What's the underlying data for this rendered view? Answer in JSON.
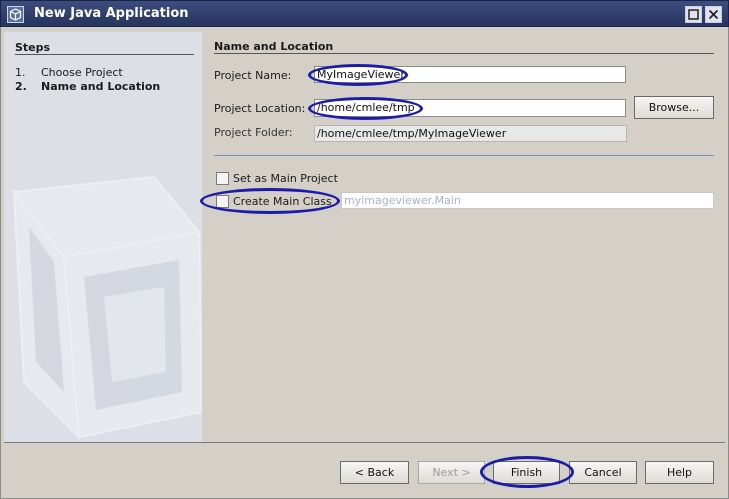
{
  "window": {
    "title": "New Java Application",
    "icons": {
      "app": "cube-icon",
      "maximize": "maximize-icon",
      "close": "close-icon"
    }
  },
  "steps": {
    "title": "Steps",
    "items": [
      {
        "num": "1.",
        "label": "Choose Project"
      },
      {
        "num": "2.",
        "label": "Name and Location"
      }
    ]
  },
  "panel": {
    "title": "Name and Location",
    "project_name_label": "Project Name:",
    "project_name_value": "MyImageViewer",
    "project_location_label": "Project Location:",
    "project_location_value": "/home/cmlee/tmp",
    "browse_label": "Browse...",
    "project_folder_label": "Project Folder:",
    "project_folder_value": "/home/cmlee/tmp/MyImageViewer",
    "set_main_label": "Set as Main Project",
    "create_main_label": "Create Main Class",
    "main_class_value": "myimageviewer.Main"
  },
  "buttons": {
    "back": "< Back",
    "next": "Next >",
    "finish": "Finish",
    "cancel": "Cancel",
    "help": "Help"
  },
  "colors": {
    "titlebar": "#2f3d6b",
    "annotation": "#1c1ca8",
    "steps_bg": "#dcdfe6"
  }
}
